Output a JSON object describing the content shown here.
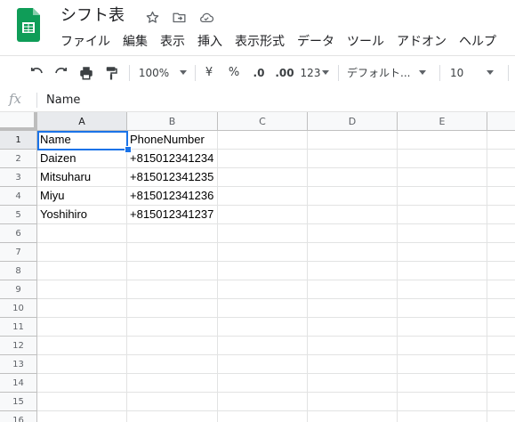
{
  "document": {
    "title": "シフト表"
  },
  "header": {
    "icons": [
      "star-icon",
      "move-to-folder-icon",
      "cloud-status-icon"
    ]
  },
  "menu": [
    "ファイル",
    "編集",
    "表示",
    "挿入",
    "表示形式",
    "データ",
    "ツール",
    "アドオン",
    "ヘルプ"
  ],
  "toolbar": {
    "zoom": "100%",
    "currency": "¥",
    "percent": "%",
    "decimal_decrease": ".0",
    "decimal_increase": ".00",
    "number_format": "123",
    "font": "デフォルト...",
    "font_size": "10"
  },
  "formula_bar": {
    "fx_label": "fx",
    "value": "Name"
  },
  "columns": [
    "A",
    "B",
    "C",
    "D",
    "E"
  ],
  "rows": [
    "1",
    "2",
    "3",
    "4",
    "5",
    "6",
    "7",
    "8",
    "9",
    "10",
    "11",
    "12",
    "13",
    "14",
    "15",
    "16"
  ],
  "cells": [
    [
      "Name",
      "PhoneNumber"
    ],
    [
      "Daizen",
      "+815012341234"
    ],
    [
      "Mitsuharu",
      "+815012341235"
    ],
    [
      "Miyu",
      "+815012341236"
    ],
    [
      "Yoshihiro",
      "+815012341237"
    ]
  ],
  "colors": {
    "accent": "#1a73e8",
    "sheets_green": "#0f9d58"
  }
}
